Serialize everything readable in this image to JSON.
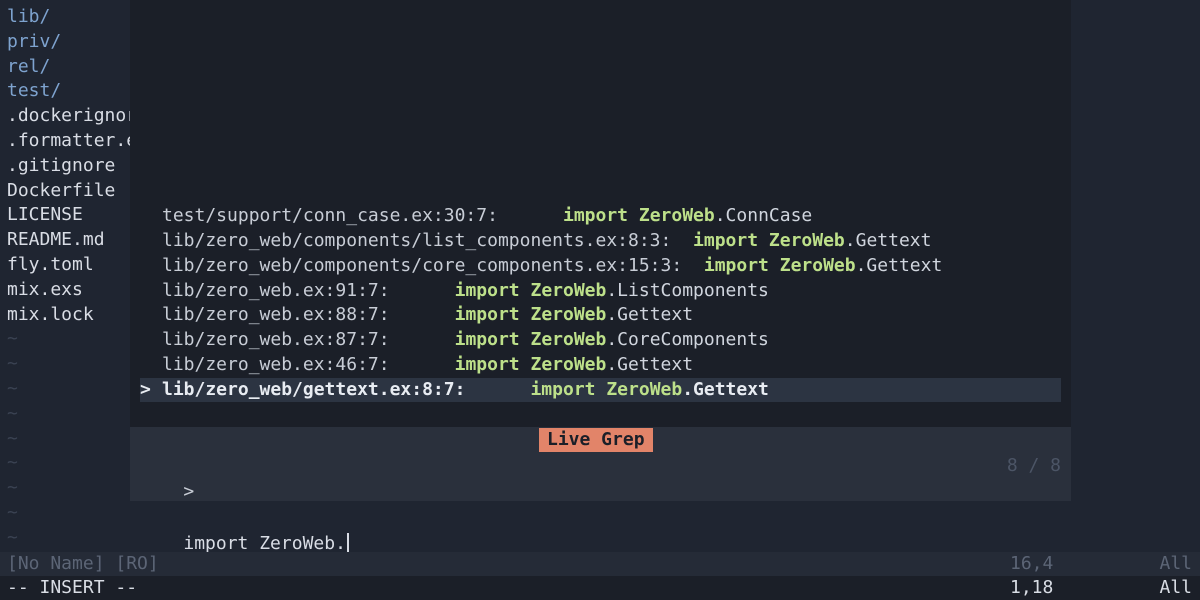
{
  "explorer": {
    "items": [
      {
        "label": "lib/",
        "kind": "dir"
      },
      {
        "label": "priv/",
        "kind": "dir"
      },
      {
        "label": "rel/",
        "kind": "dir"
      },
      {
        "label": "test/",
        "kind": "dir"
      },
      {
        "label": ".dockerignor",
        "kind": "file"
      },
      {
        "label": ".formatter.e",
        "kind": "file"
      },
      {
        "label": ".gitignore",
        "kind": "file"
      },
      {
        "label": "Dockerfile",
        "kind": "file"
      },
      {
        "label": "LICENSE",
        "kind": "file"
      },
      {
        "label": "README.md",
        "kind": "file"
      },
      {
        "label": "fly.toml",
        "kind": "file"
      },
      {
        "label": "mix.exs",
        "kind": "file"
      },
      {
        "label": "mix.lock",
        "kind": "file"
      }
    ],
    "empty_marker": "~"
  },
  "results": [
    {
      "path": "test/support/conn_case.ex:30:7:",
      "gap": "      ",
      "keyword": "import",
      "module": "ZeroWeb",
      "rest": ".ConnCase",
      "selected": false
    },
    {
      "path": "lib/zero_web/components/list_components.ex:8:3:",
      "gap": "  ",
      "keyword": "import",
      "module": "ZeroWeb",
      "rest": ".Gettext",
      "selected": false
    },
    {
      "path": "lib/zero_web/components/core_components.ex:15:3:",
      "gap": "  ",
      "keyword": "import",
      "module": "ZeroWeb",
      "rest": ".Gettext",
      "selected": false
    },
    {
      "path": "lib/zero_web.ex:91:7:",
      "gap": "      ",
      "keyword": "import",
      "module": "ZeroWeb",
      "rest": ".ListComponents",
      "selected": false
    },
    {
      "path": "lib/zero_web.ex:88:7:",
      "gap": "      ",
      "keyword": "import",
      "module": "ZeroWeb",
      "rest": ".Gettext",
      "selected": false
    },
    {
      "path": "lib/zero_web.ex:87:7:",
      "gap": "      ",
      "keyword": "import",
      "module": "ZeroWeb",
      "rest": ".CoreComponents",
      "selected": false
    },
    {
      "path": "lib/zero_web.ex:46:7:",
      "gap": "      ",
      "keyword": "import",
      "module": "ZeroWeb",
      "rest": ".Gettext",
      "selected": false
    },
    {
      "path": "lib/zero_web/gettext.ex:8:7:",
      "gap": "      ",
      "keyword": "import",
      "module": "ZeroWeb",
      "rest": ".Gettext",
      "selected": true
    }
  ],
  "selection_caret": ">",
  "prompt": {
    "title": "Live Grep",
    "prefix": ">",
    "value": "import ZeroWeb.",
    "counter": "8 / 8"
  },
  "statusline": {
    "buffer": "[No Name] [RO]",
    "position": "16,4",
    "scroll": "All"
  },
  "cmdline": {
    "mode": "-- INSERT --",
    "position": "1,18",
    "scroll": "All"
  },
  "colors": {
    "background": "#1f2531",
    "results_bg": "#1b1f28",
    "prompt_bg": "#2a303c",
    "title_badge": "#e28469",
    "match_highlight": "#bde08a",
    "directory": "#7ea3cf"
  }
}
